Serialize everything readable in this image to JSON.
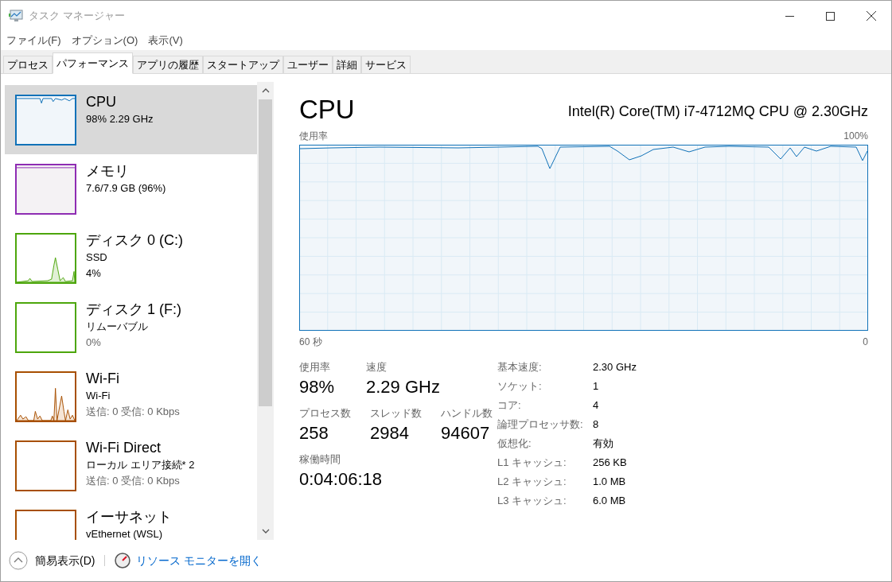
{
  "window": {
    "title": "タスク マネージャー"
  },
  "menu": [
    "ファイル(F)",
    "オプション(O)",
    "表示(V)"
  ],
  "tabs": [
    {
      "label": "プロセス",
      "selected": false
    },
    {
      "label": "パフォーマンス",
      "selected": true
    },
    {
      "label": "アプリの履歴",
      "selected": false
    },
    {
      "label": "スタートアップ",
      "selected": false
    },
    {
      "label": "ユーザー",
      "selected": false
    },
    {
      "label": "詳細",
      "selected": false
    },
    {
      "label": "サービス",
      "selected": false
    }
  ],
  "sidebar": {
    "items": [
      {
        "kind": "cpu",
        "title": "CPU",
        "lines": [
          "98% 2.29 GHz"
        ],
        "selected": true,
        "color": "#1172b8"
      },
      {
        "kind": "memory",
        "title": "メモリ",
        "lines": [
          "7.6/7.9 GB (96%)"
        ],
        "selected": false,
        "color": "#8e2cb3"
      },
      {
        "kind": "disk",
        "title": "ディスク 0 (C:)",
        "lines": [
          "SSD",
          "4%"
        ],
        "selected": false,
        "color": "#4da60c"
      },
      {
        "kind": "empty",
        "title": "ディスク 1 (F:)",
        "lines": [
          "リムーバブル",
          "0%"
        ],
        "selected": false,
        "color": "#4da60c"
      },
      {
        "kind": "network",
        "title": "Wi-Fi",
        "lines": [
          "Wi-Fi",
          "送信: 0 受信: 0 Kbps"
        ],
        "selected": false,
        "color": "#a74f01"
      },
      {
        "kind": "empty",
        "title": "Wi-Fi Direct",
        "lines": [
          "ローカル エリア接続* 2",
          "送信: 0 受信: 0 Kbps"
        ],
        "selected": false,
        "color": "#a74f01"
      },
      {
        "kind": "empty",
        "title": "イーサネット",
        "lines": [
          "vEthernet (WSL)"
        ],
        "selected": false,
        "color": "#a74f01"
      }
    ]
  },
  "detail": {
    "title": "CPU",
    "model": "Intel(R) Core(TM) i7-4712MQ CPU @ 2.30GHz",
    "graph": {
      "label": "使用率",
      "max_label": "100%",
      "time_label": "60 秒",
      "min_label": "0"
    },
    "stats": [
      [
        {
          "label": "使用率",
          "value": "98%"
        },
        {
          "label": "速度",
          "value": "2.29 GHz"
        }
      ],
      [
        {
          "label": "プロセス数",
          "value": "258"
        },
        {
          "label": "スレッド数",
          "value": "2984"
        },
        {
          "label": "ハンドル数",
          "value": "94607"
        }
      ],
      [
        {
          "label": "稼働時間",
          "value": "0:04:06:18"
        }
      ]
    ],
    "specs": [
      {
        "label": "基本速度:",
        "value": "2.30 GHz"
      },
      {
        "label": "ソケット:",
        "value": "1"
      },
      {
        "label": "コア:",
        "value": "4"
      },
      {
        "label": "論理プロセッサ数:",
        "value": "8"
      },
      {
        "label": "仮想化:",
        "value": "有効"
      },
      {
        "label": "L1 キャッシュ:",
        "value": "256 KB"
      },
      {
        "label": "L2 キャッシュ:",
        "value": "1.0 MB"
      },
      {
        "label": "L3 キャッシュ:",
        "value": "6.0 MB"
      }
    ]
  },
  "footer": {
    "fewer_details": "簡易表示(D)",
    "resource_monitor": "リソース モニターを開く"
  }
}
